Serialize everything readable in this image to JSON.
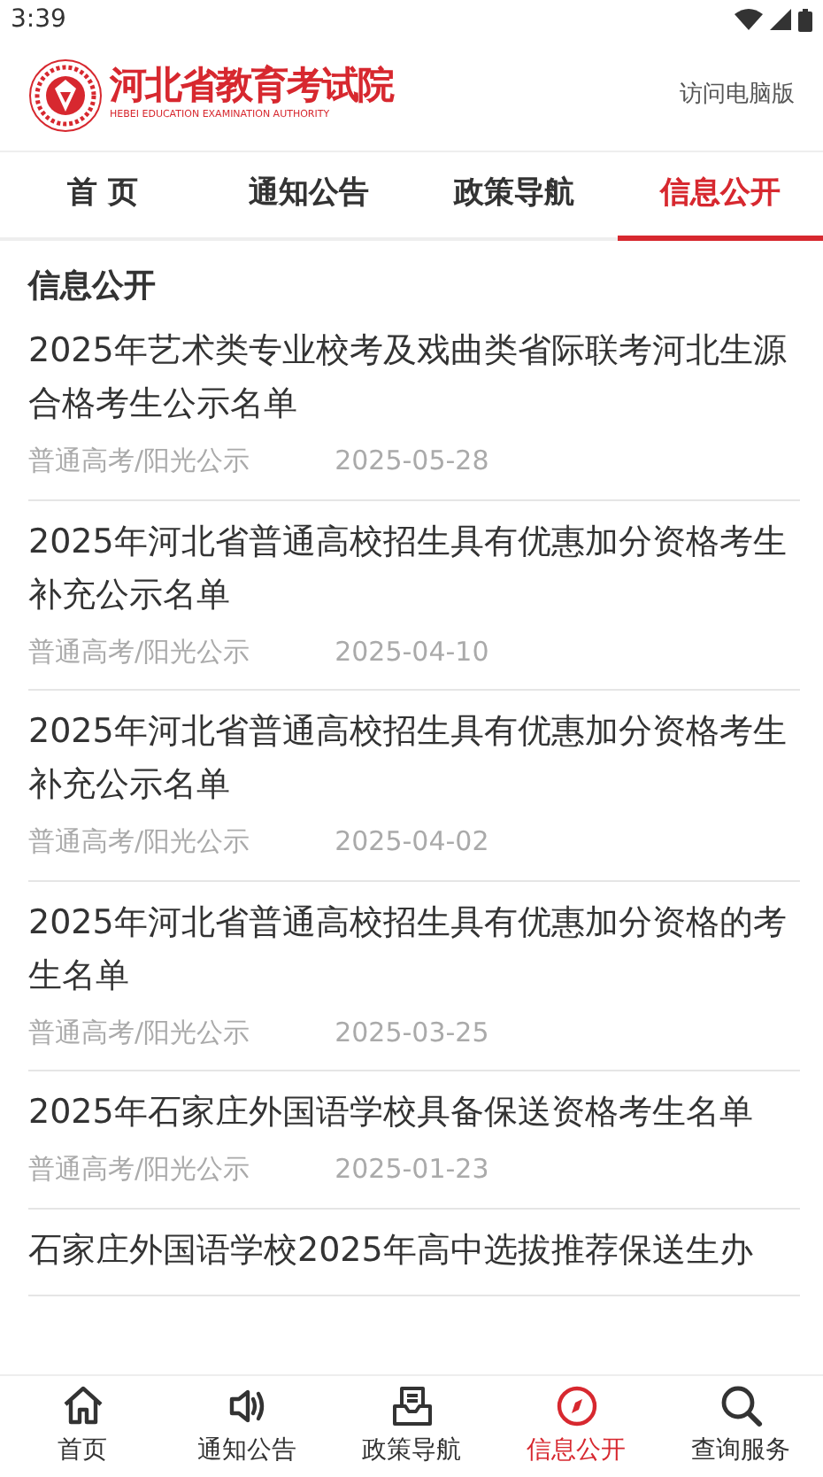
{
  "status_bar": {
    "time": "3:39"
  },
  "header": {
    "logo_title": "河北省教育考试院",
    "logo_subtitle": "HEBEI EDUCATION EXAMINATION AUTHORITY",
    "desktop_link": "访问电脑版"
  },
  "tabs": [
    {
      "label": "首 页",
      "selected": false
    },
    {
      "label": "通知公告",
      "selected": false
    },
    {
      "label": "政策导航",
      "selected": false
    },
    {
      "label": "信息公开",
      "selected": true
    }
  ],
  "section_title": "信息公开",
  "articles": [
    {
      "title": "2025年艺术类专业校考及戏曲类省际联考河北生源合格考生公示名单",
      "category": "普通高考/阳光公示",
      "date": "2025-05-28"
    },
    {
      "title": "2025年河北省普通高校招生具有优惠加分资格考生补充公示名单",
      "category": "普通高考/阳光公示",
      "date": "2025-04-10"
    },
    {
      "title": "2025年河北省普通高校招生具有优惠加分资格考生补充公示名单",
      "category": "普通高考/阳光公示",
      "date": "2025-04-02"
    },
    {
      "title": "2025年河北省普通高校招生具有优惠加分资格的考生名单",
      "category": "普通高考/阳光公示",
      "date": "2025-03-25"
    },
    {
      "title": "2025年石家庄外国语学校具备保送资格考生名单",
      "category": "普通高考/阳光公示",
      "date": "2025-01-23"
    },
    {
      "title": "石家庄外国语学校2025年高中选拔推荐保送生办"
    }
  ],
  "bottom_nav": [
    {
      "kind": "home",
      "label": "首页",
      "selected": false
    },
    {
      "kind": "speaker",
      "label": "通知公告",
      "selected": false
    },
    {
      "kind": "inbox",
      "label": "政策导航",
      "selected": false
    },
    {
      "kind": "compass",
      "label": "信息公开",
      "selected": true
    },
    {
      "kind": "search",
      "label": "查询服务",
      "selected": false
    }
  ]
}
